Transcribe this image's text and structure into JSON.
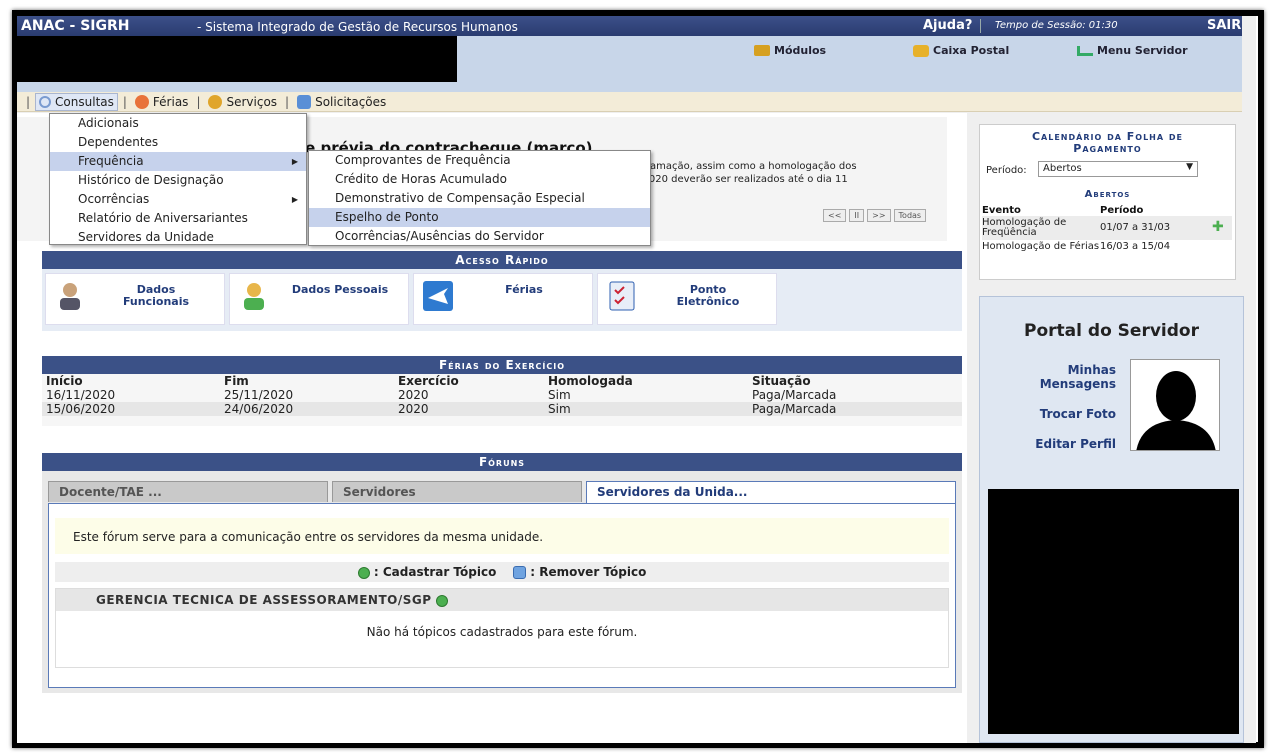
{
  "header": {
    "app_name": "ANAC - SIGRH",
    "subtitle": "- Sistema Integrado de Gestão de Recursos Humanos",
    "help": "Ajuda?",
    "session": "Tempo de Sessão: 01:30",
    "logout": "SAIR"
  },
  "shortcuts": {
    "modulos": "Módulos",
    "caixa_postal": "Caixa Postal",
    "menu_servidor": "Menu Servidor"
  },
  "menu": {
    "consultas": "Consultas",
    "ferias": "Férias",
    "servicos": "Serviços",
    "solicitacoes": "Solicitações"
  },
  "consultas_items": [
    "Adicionais",
    "Dependentes",
    "Frequência",
    "Histórico de Designação",
    "Ocorrências",
    "Relatório de Aniversariantes",
    "Servidores da Unidade"
  ],
  "frequencia_items": [
    "Comprovantes de Frequência",
    "Crédito de Horas Acumulado",
    "Demonstrativo de Compensação Especial",
    "Espelho de Ponto",
    "Ocorrências/Ausências do Servidor"
  ],
  "news": {
    "title_visible": "eb e prévia do contracheque (março)",
    "text_line1": "eprogramação, assim como a homologação dos",
    "text_line2": "abril/2020 deverão ser realizados até o dia 11",
    "pager": [
      "<<",
      "II",
      ">>",
      "Todas"
    ]
  },
  "acesso": {
    "title": "Acesso Rápido",
    "items": [
      {
        "label": "Dados Funcionais"
      },
      {
        "label": "Dados Pessoais"
      },
      {
        "label": "Férias"
      },
      {
        "label": "Ponto Eletrônico"
      }
    ]
  },
  "ferias_exercicio": {
    "title": "Férias do Exercício",
    "headers": [
      "Início",
      "Fim",
      "Exercício",
      "Homologada",
      "Situação"
    ],
    "rows": [
      [
        "16/11/2020",
        "25/11/2020",
        "2020",
        "Sim",
        "Paga/Marcada"
      ],
      [
        "15/06/2020",
        "24/06/2020",
        "2020",
        "Sim",
        "Paga/Marcada"
      ]
    ]
  },
  "foruns": {
    "title": "Fóruns",
    "tabs": [
      "Docente/TAE ...",
      "Servidores",
      "Servidores da Unida..."
    ],
    "description": "Este fórum serve para a comunicação entre os servidores da mesma unidade.",
    "cadastrar": ": Cadastrar Tópico",
    "remover": ": Remover Tópico",
    "group": "GERENCIA TECNICA DE ASSESSORAMENTO/SGP",
    "empty": "Não há tópicos cadastrados para este fórum."
  },
  "calendario": {
    "title": "Calendário da Folha de Pagamento",
    "period_label": "Período:",
    "period_value": "Abertos",
    "abertos": "Abertos",
    "col_evento": "Evento",
    "col_periodo": "Período",
    "rows": [
      {
        "evento": "Homologação de Freqüência",
        "periodo": "01/07 a 31/03"
      },
      {
        "evento": "Homologação de Férias",
        "periodo": "16/03 a 15/04"
      }
    ]
  },
  "portal": {
    "title": "Portal do Servidor",
    "mensagens": "Minhas Mensagens",
    "trocar_foto": "Trocar Foto",
    "editar_perfil": "Editar Perfil"
  }
}
